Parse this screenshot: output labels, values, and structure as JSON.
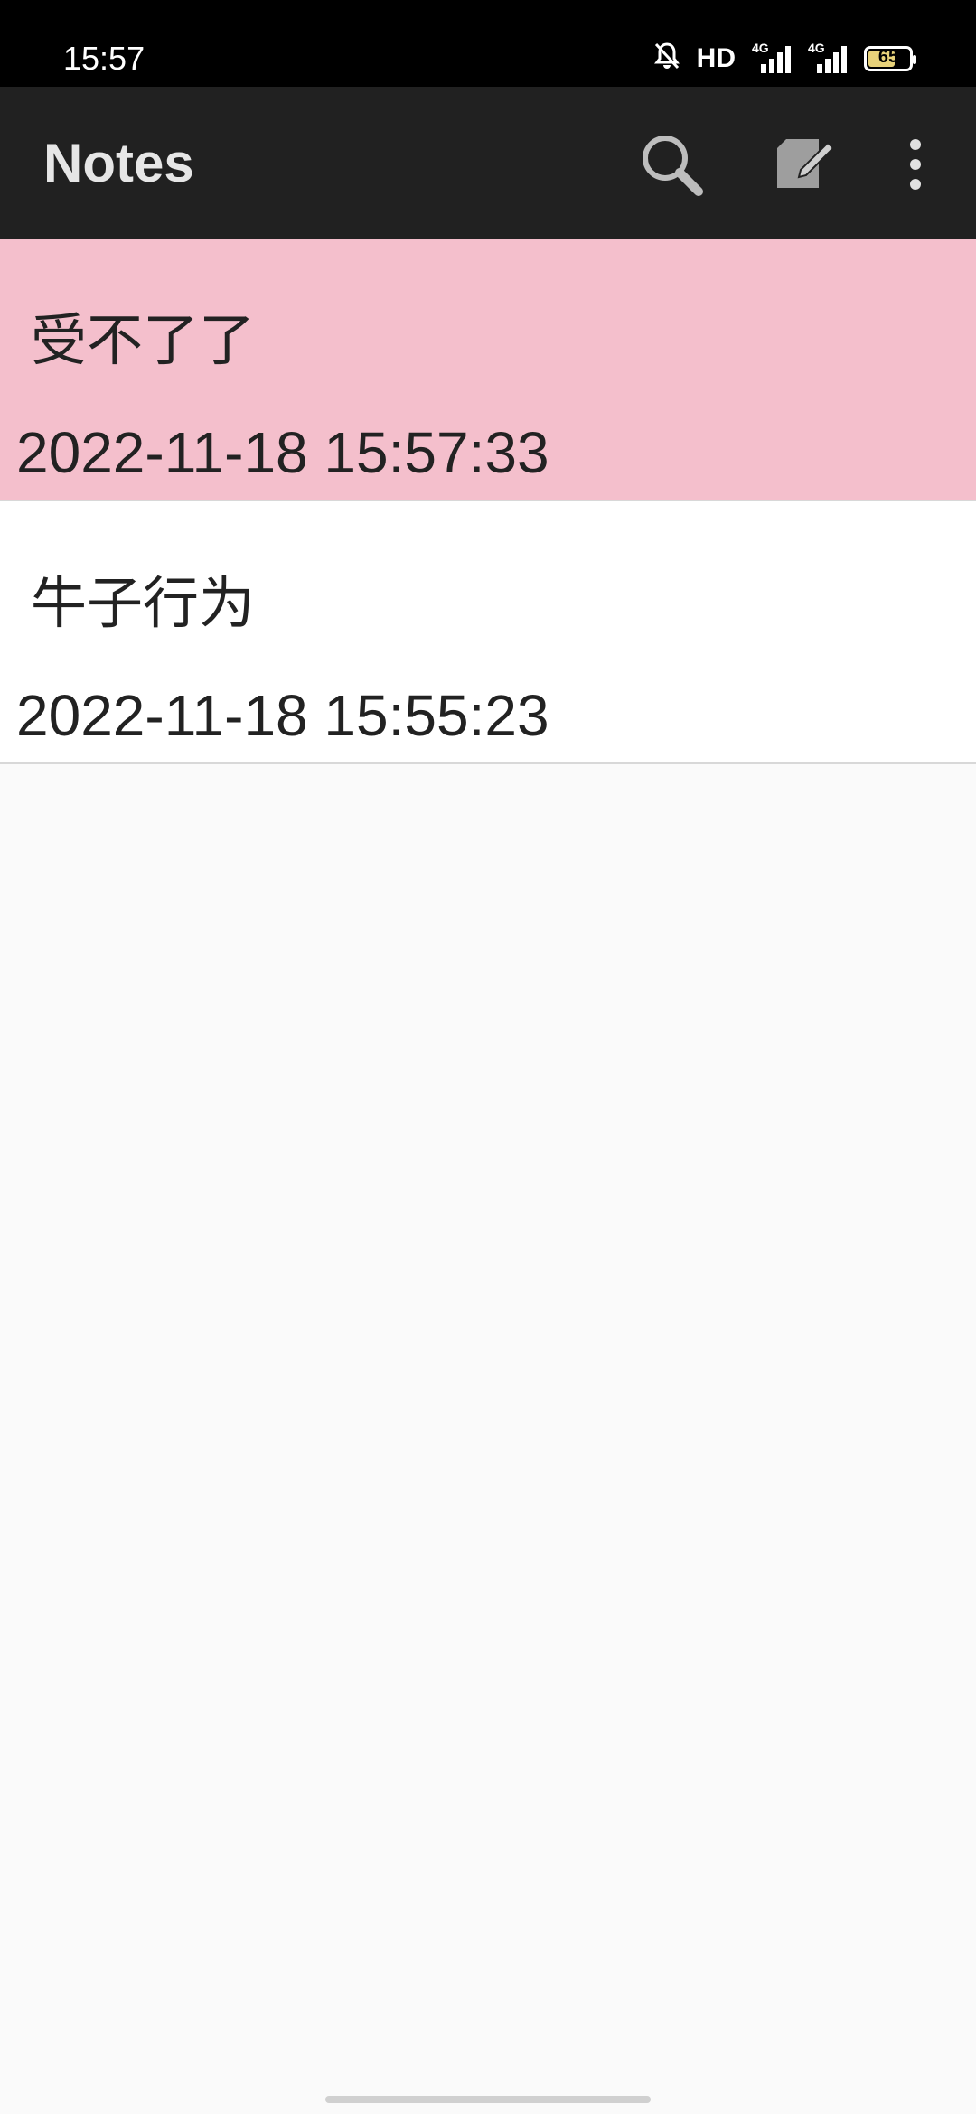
{
  "status_bar": {
    "time": "15:57",
    "hd_label": "HD",
    "network_1": "4G",
    "network_2": "4G",
    "battery_level": "65",
    "battery_fraction": 0.65
  },
  "app_bar": {
    "title": "Notes",
    "icons": [
      "search-icon",
      "edit-note-icon",
      "more-vert-icon"
    ]
  },
  "notes": [
    {
      "title": "受不了了",
      "time": "2022-11-18 15:57:33",
      "color": "#f4bfcc"
    },
    {
      "title": "牛子行为",
      "time": "2022-11-18 15:55:23",
      "color": "#ffffff"
    }
  ],
  "colors": {
    "status_bar": "#000000",
    "app_bar": "#212121",
    "background": "#fafafa"
  }
}
